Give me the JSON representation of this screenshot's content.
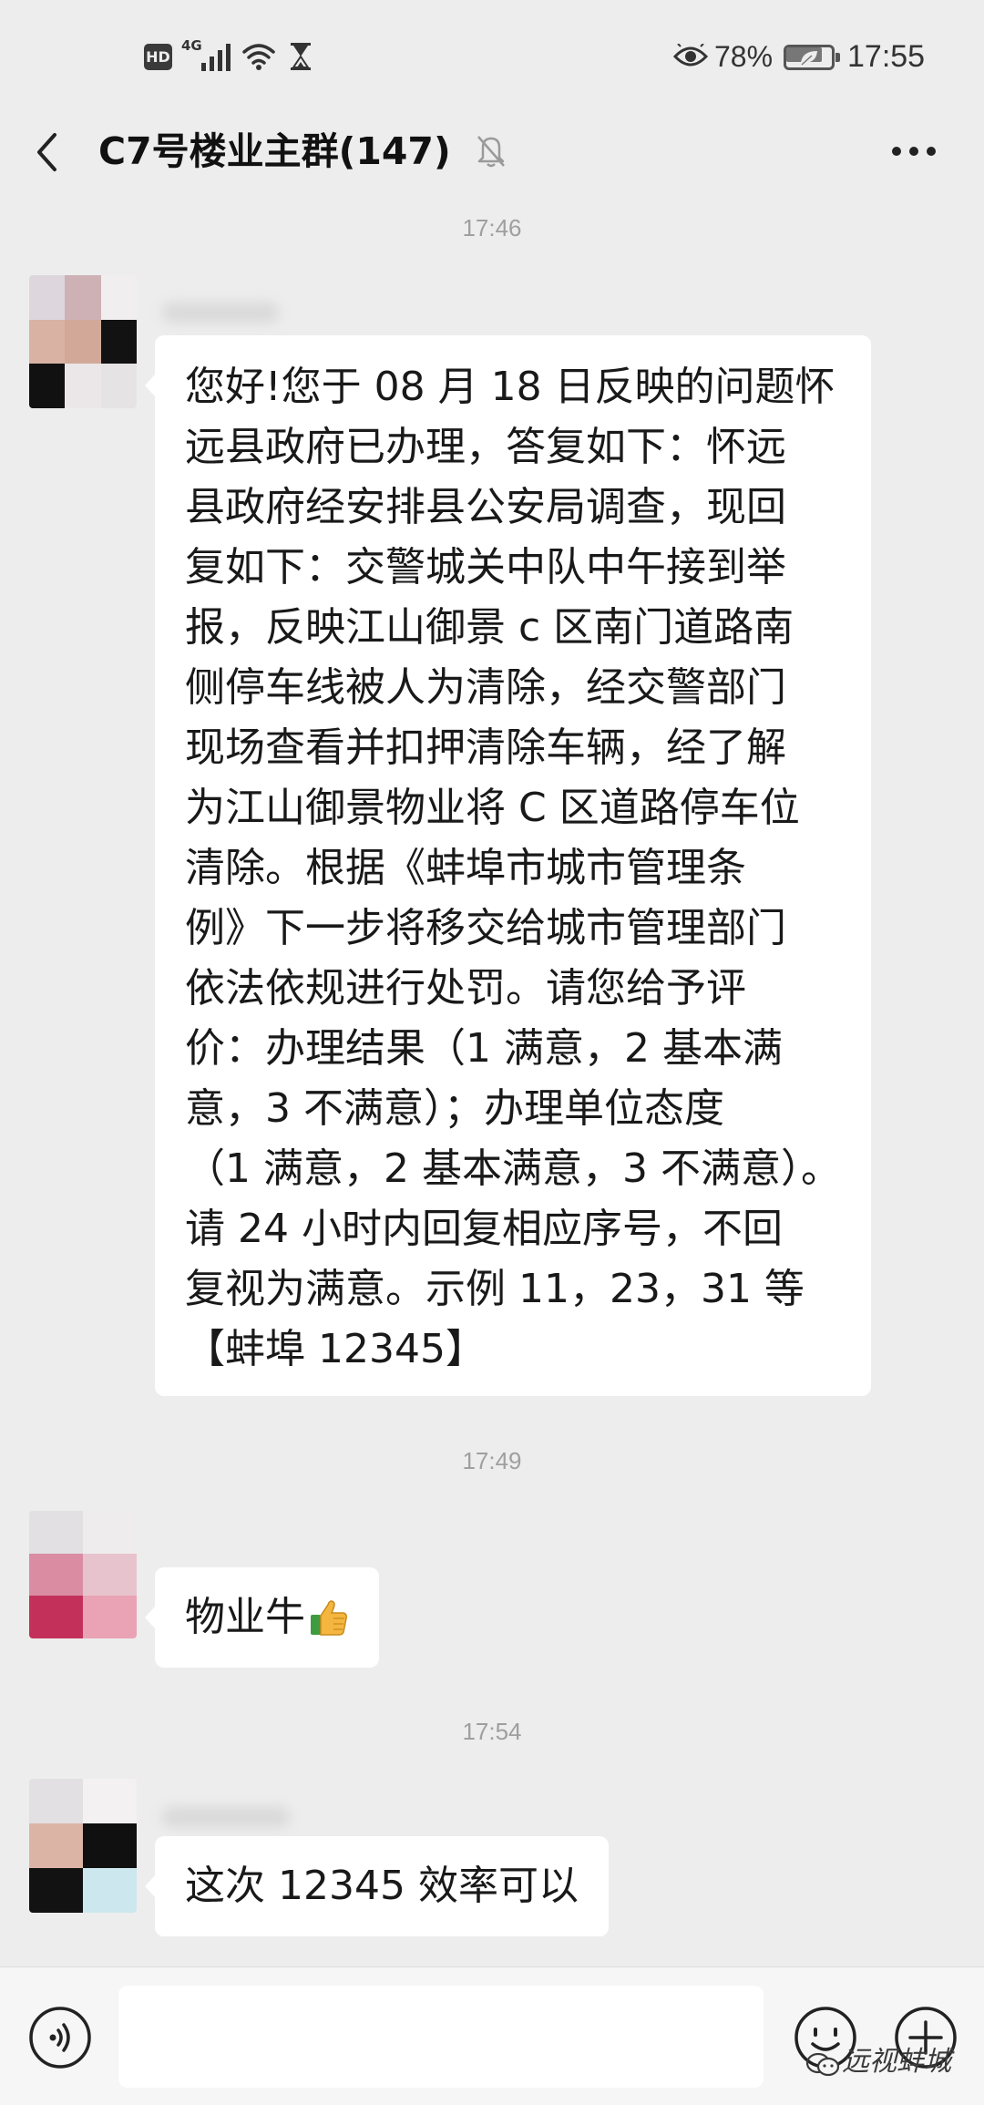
{
  "status_bar": {
    "hd_label": "HD",
    "network_label": "4G",
    "battery_percent": "78%",
    "battery_level": 0.78,
    "time": "17:55",
    "icons": [
      "signal-icon",
      "wifi-icon",
      "hourglass-icon",
      "eye-comfort-icon",
      "battery-icon"
    ]
  },
  "header": {
    "title": "C7号楼业主群(147)",
    "icons": [
      "back-arrow-icon",
      "mute-bell-icon",
      "more-dots-icon"
    ]
  },
  "chat": {
    "messages": [
      {
        "time": "17:46",
        "lines": [
          "您好!您于 08 月 18 日反映的问题怀",
          "远县政府已办理，答复如下：怀远",
          "县政府经安排县公安局调查，现回",
          "复如下：交警城关中队中午接到举",
          "报，反映江山御景 c 区南门道路南",
          "侧停车线被人为清除，经交警部门",
          "现场查看并扣押清除车辆，经了解",
          "为江山御景物业将 C 区道路停车位",
          "清除。根据《蚌埠市城市管理条",
          "例》下一步将移交给城市管理部门",
          "依法依规进行处罚。请您给予评",
          "价：办理结果（1 满意，2 基本满",
          "意，3 不满意）；办理单位态度",
          "（1 满意，2 基本满意，3 不满意）。",
          "请 24 小时内回复相应序号，不回",
          "复视为满意。示例 11，23，31 等",
          "【蚌埠 12345】"
        ]
      },
      {
        "time": "17:49",
        "text": "物业牛",
        "emoji": "thumbs-up-icon"
      },
      {
        "time": "17:54",
        "text": "这次 12345 效率可以"
      }
    ]
  },
  "input_bar": {
    "icons": [
      "voice-icon",
      "emoji-icon",
      "plus-icon"
    ]
  },
  "watermark": {
    "text": "远视蚌城",
    "icon": "official-account-logo-icon"
  },
  "colors": {
    "background": "#ededed",
    "bubble": "#ffffff",
    "text": "#191919",
    "timestamp": "#9f9f9f",
    "input_bar": "#f6f6f6"
  }
}
